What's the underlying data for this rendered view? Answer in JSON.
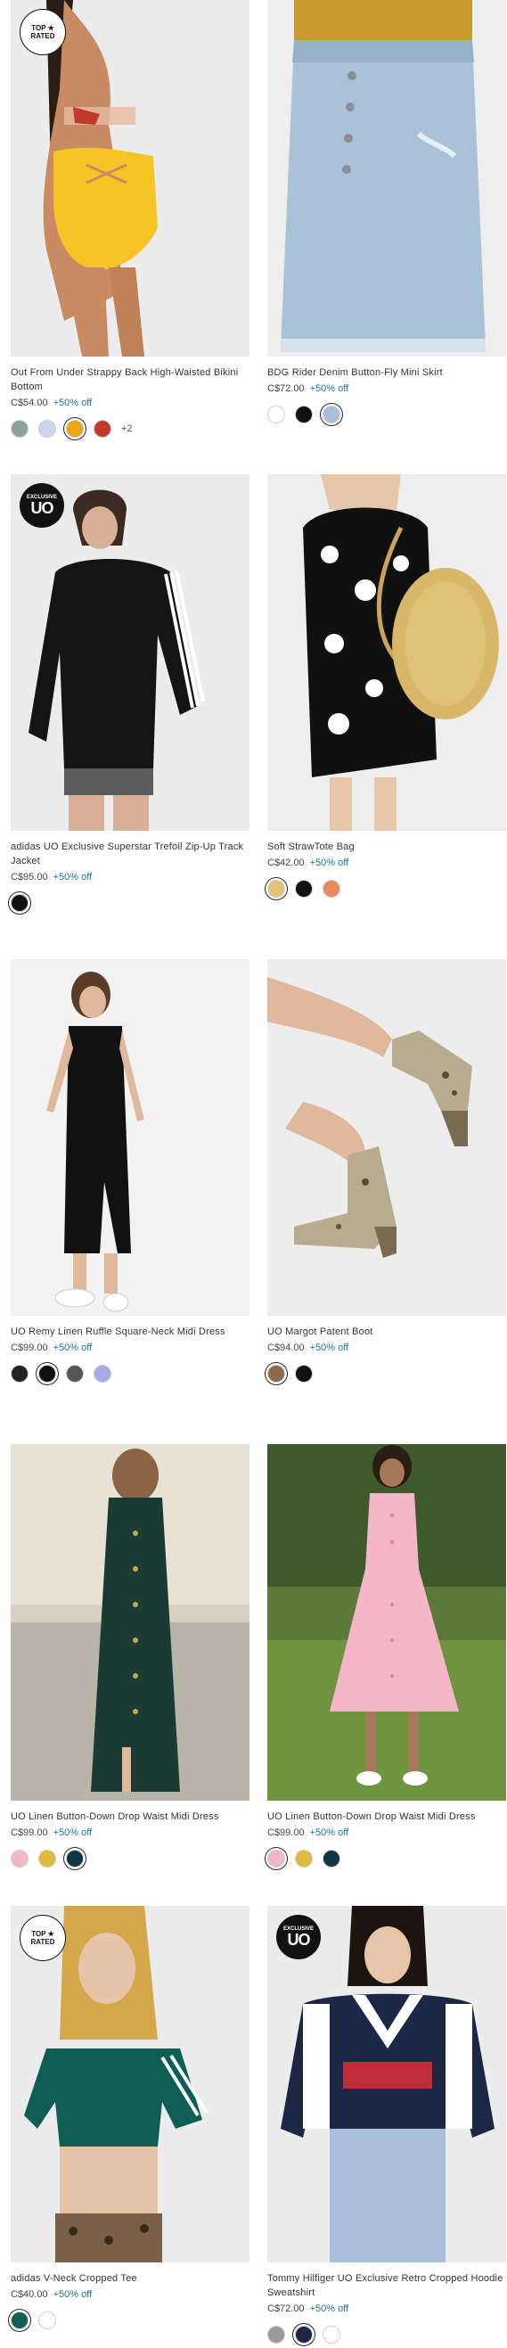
{
  "products": [
    {
      "name": "Out From Under Strappy Back High-Waisted Bikini Bottom",
      "price": "C$54.00",
      "discount": "+50% off",
      "badge": "TOP ★ RATED",
      "badge_type": "top",
      "swatches": [
        "#8aa39a",
        "#c9d8ea",
        "#e8a817",
        "#c0392b"
      ],
      "more": "+2"
    },
    {
      "name": "BDG Rider Denim Button-Fly Mini Skirt",
      "price": "C$72.00",
      "discount": "+50% off",
      "swatches": [
        "#ffffff",
        "#111111",
        "#a9bfd9"
      ]
    },
    {
      "name": "adidas UO Exclusive Superstar Trefoil Zip-Up Track Jacket",
      "price": "C$95.00",
      "discount": "+50% off",
      "badge": "UO",
      "badge_sub": "EXCLUSIVE",
      "badge_type": "uo",
      "swatches": [
        "#111111"
      ]
    },
    {
      "name": "Soft StrawTote Bag",
      "price": "C$42.00",
      "discount": "+50% off",
      "swatches": [
        "#e3c276",
        "#111111",
        "#e88a5a"
      ]
    },
    {
      "name": "UO Remy Linen Ruffle Square-Neck Midi Dress",
      "price": "C$99.00",
      "discount": "+50% off",
      "swatches": [
        "#222222",
        "#111111",
        "#555555",
        "#a9a9e8"
      ]
    },
    {
      "name": "UO Margot Patent Boot",
      "price": "C$94.00",
      "discount": "+50% off",
      "swatches": [
        "#8b6a4a",
        "#111111"
      ]
    },
    {
      "name": "UO Linen Button-Down Drop Waist Midi Dress",
      "price": "C$99.00",
      "discount": "+50% off",
      "swatches": [
        "#f2b8c6",
        "#e2b93b",
        "#123642"
      ]
    },
    {
      "name": "UO Linen Button-Down Drop Waist Midi Dress",
      "price": "C$99.00",
      "discount": "+50% off",
      "swatches": [
        "#f2b8c6",
        "#e2b93b",
        "#123642"
      ]
    },
    {
      "name": "adidas V-Neck Cropped Tee",
      "price": "C$40.00",
      "discount": "+50% off",
      "badge": "TOP ★ RATED",
      "badge_type": "top",
      "swatches": [
        "#0f5e55",
        "#ffffff"
      ]
    },
    {
      "name": "Tommy Hilfiger UO Exclusive Retro Cropped Hoodie Sweatshirt",
      "price": "C$72.00",
      "discount": "+50% off",
      "badge": "UO",
      "badge_sub": "EXCLUSIVE",
      "badge_type": "uo",
      "swatches": [
        "#9a9a9a",
        "#1c2745",
        "#ffffff"
      ]
    }
  ]
}
